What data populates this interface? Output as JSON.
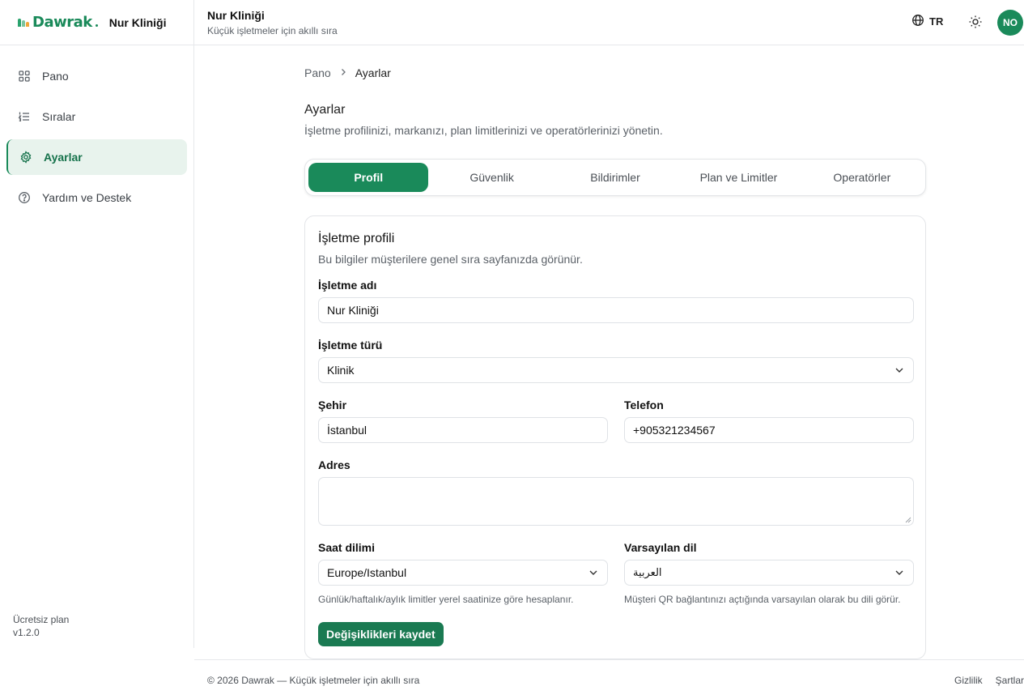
{
  "brand": {
    "logo_text": "Dawrak",
    "org_name": "Nur Kliniği",
    "accent_color": "#1a8a5a"
  },
  "sidebar": {
    "items": [
      {
        "label": "Pano",
        "icon": "grid-icon"
      },
      {
        "label": "Sıralar",
        "icon": "list-ordered-icon"
      },
      {
        "label": "Ayarlar",
        "icon": "gear-icon",
        "active": true
      },
      {
        "label": "Yardım ve Destek",
        "icon": "help-circle-icon"
      }
    ],
    "plan_name": "Ücretsiz plan",
    "version": "v1.2.0"
  },
  "topbar": {
    "title": "Nur Kliniği",
    "subtitle": "Küçük işletmeler için akıllı sıra",
    "language": "TR",
    "avatar_initials": "NO"
  },
  "breadcrumb": {
    "parent": "Pano",
    "current": "Ayarlar"
  },
  "page": {
    "title": "Ayarlar",
    "description": "İşletme profilinizi, markanızı, plan limitlerinizi ve operatörlerinizi yönetin."
  },
  "tabs": [
    {
      "label": "Profil",
      "active": true
    },
    {
      "label": "Güvenlik"
    },
    {
      "label": "Bildirimler"
    },
    {
      "label": "Plan ve Limitler"
    },
    {
      "label": "Operatörler"
    }
  ],
  "profile_card": {
    "title": "İşletme profili",
    "description": "Bu bilgiler müşterilere genel sıra sayfanızda görünür.",
    "business_name": {
      "label": "İşletme adı",
      "value": "Nur Kliniği"
    },
    "business_type": {
      "label": "İşletme türü",
      "value": "Klinik"
    },
    "city": {
      "label": "Şehir",
      "value": "İstanbul"
    },
    "phone": {
      "label": "Telefon",
      "value": "+905321234567"
    },
    "address": {
      "label": "Adres",
      "value": ""
    },
    "timezone": {
      "label": "Saat dilimi",
      "value": "Europe/Istanbul",
      "hint": "Günlük/haftalık/aylık limitler yerel saatinize göre hesaplanır."
    },
    "default_language": {
      "label": "Varsayılan dil",
      "value": "العربية",
      "hint": "Müşteri QR bağlantınızı açtığında varsayılan olarak bu dili görür."
    },
    "save_label": "Değişiklikleri kaydet"
  },
  "footer": {
    "copyright": "© 2026 Dawrak — Küçük işletmeler için akıllı sıra",
    "links": [
      "Gizlilik",
      "Şartlar"
    ]
  }
}
